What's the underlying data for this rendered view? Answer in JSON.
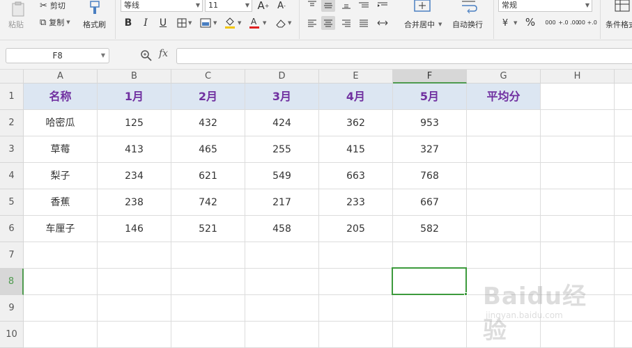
{
  "ribbon": {
    "paste": "粘贴",
    "cut": "剪切",
    "copy": "复制",
    "format_painter": "格式刷",
    "font_name": "等线",
    "font_size": "11",
    "merge_center": "合并居中",
    "wrap_text": "自动换行",
    "number_format": "常规",
    "percent": "%",
    "thousands": "000",
    "inc_decimal": "+.0 .00",
    "dec_decimal": ".00 +.0",
    "conditional_format": "条件格式"
  },
  "formula_bar": {
    "name_box": "F8",
    "fx": "fx",
    "content": ""
  },
  "sheet": {
    "columns": [
      "A",
      "B",
      "C",
      "D",
      "E",
      "F",
      "G",
      "H"
    ],
    "active_column": "F",
    "rows": [
      "1",
      "2",
      "3",
      "4",
      "5",
      "6",
      "7",
      "8",
      "9",
      "10"
    ],
    "active_row": "8",
    "header": [
      "名称",
      "1月",
      "2月",
      "3月",
      "4月",
      "5月",
      "平均分"
    ],
    "data": [
      [
        "哈密瓜",
        "125",
        "432",
        "424",
        "362",
        "953",
        ""
      ],
      [
        "草莓",
        "413",
        "465",
        "255",
        "415",
        "327",
        ""
      ],
      [
        "梨子",
        "234",
        "621",
        "549",
        "663",
        "768",
        ""
      ],
      [
        "香蕉",
        "238",
        "742",
        "217",
        "233",
        "667",
        ""
      ],
      [
        "车厘子",
        "146",
        "521",
        "458",
        "205",
        "582",
        ""
      ]
    ],
    "header_fill": "#dce6f2",
    "header_text_color": "#7030a0",
    "selection_color": "#3c9a3c"
  },
  "watermark": {
    "logo": "Baidu经验",
    "url": "jingyan.baidu.com"
  }
}
